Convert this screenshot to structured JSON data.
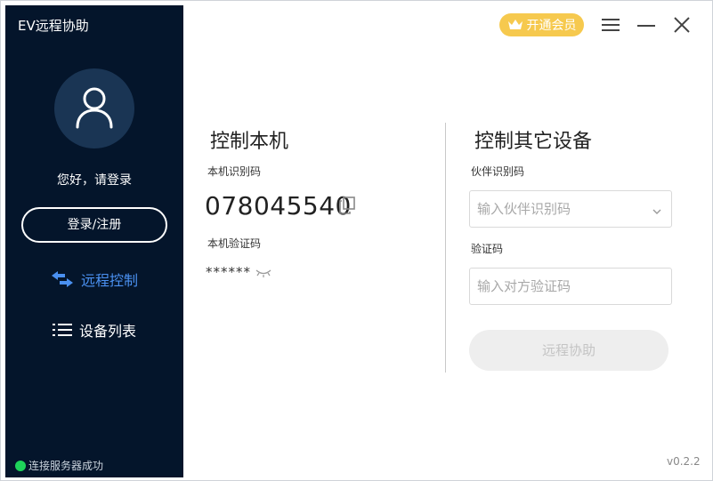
{
  "app": {
    "title": "EV远程协助",
    "version": "v0.2.2"
  },
  "sidebar": {
    "greeting": "您好，请登录",
    "login_label": "登录/注册",
    "nav": [
      {
        "label": "远程控制",
        "icon": "swap-arrows-icon",
        "active": true
      },
      {
        "label": "设备列表",
        "icon": "list-icon",
        "active": false
      }
    ],
    "status": "连接服务器成功",
    "status_color": "#1ed35a"
  },
  "topbar": {
    "vip_label": "开通会员",
    "vip_icon": "crown-icon",
    "controls": [
      "menu-icon",
      "minimize-icon",
      "close-icon"
    ]
  },
  "local": {
    "title": "控制本机",
    "id_label": "本机识别码",
    "id_value": "078045540",
    "pass_label": "本机验证码",
    "pass_value": "******"
  },
  "remote": {
    "title": "控制其它设备",
    "partner_label": "伙伴识别码",
    "partner_placeholder": "输入伙伴识别码",
    "code_label": "验证码",
    "code_placeholder": "输入对方验证码",
    "submit_label": "远程协助"
  },
  "colors": {
    "sidebar_bg": "#04152b",
    "accent": "#4a90f0",
    "vip": "#f6c94e"
  }
}
